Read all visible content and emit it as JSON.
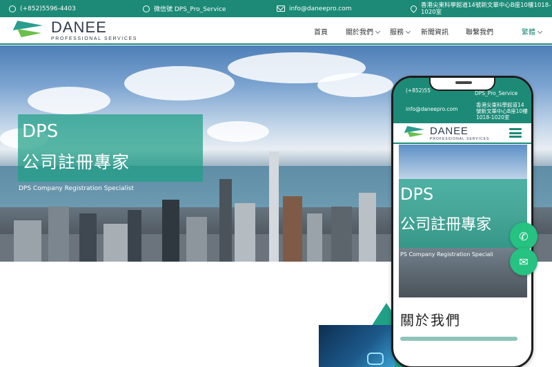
{
  "topbar": {
    "phone": "(+852)5596-4403",
    "wechat": "微信號 DPS_Pro_Service",
    "email": "info@daneepro.com",
    "address_line1": "香港尖東科學館道14號新文華中心B座10樓1018-",
    "address_line2": "1020室"
  },
  "logo": {
    "name": "DANEE",
    "subtitle": "PROFESSIONAL SERVICES"
  },
  "nav": {
    "home": "首頁",
    "about": "關於我們",
    "services": "服務",
    "news": "新聞資訊",
    "contact": "聯繫我們",
    "lang": "繁體"
  },
  "hero": {
    "title_line1": "DPS",
    "title_line2": "公司註冊專家",
    "subtitle": "DPS Company Registration Specialist"
  },
  "phone": {
    "phone": "(+852)55",
    "wechat": "DPS_Pro_Service",
    "email": "info@daneepro.com",
    "address_line1": "香港尖東科學館道14",
    "address_line2": "號新文華中心B座10樓",
    "address_line3": "1018-1020室",
    "logo_name": "DANEE",
    "logo_sub": "PROFESSIONAL SERVICES",
    "hero_title_line1": "DPS",
    "hero_title_line2": "公司註冊專家",
    "hero_subtitle": "PS Company Registration Speciali",
    "about_heading": "關於我們"
  },
  "colors": {
    "brand_green": "#1c8a77",
    "accent_teal": "#1fa087",
    "whatsapp_green": "#26c281"
  },
  "icons": [
    "whatsapp-icon",
    "wechat-icon",
    "mail-icon",
    "location-icon",
    "menu-icon"
  ]
}
